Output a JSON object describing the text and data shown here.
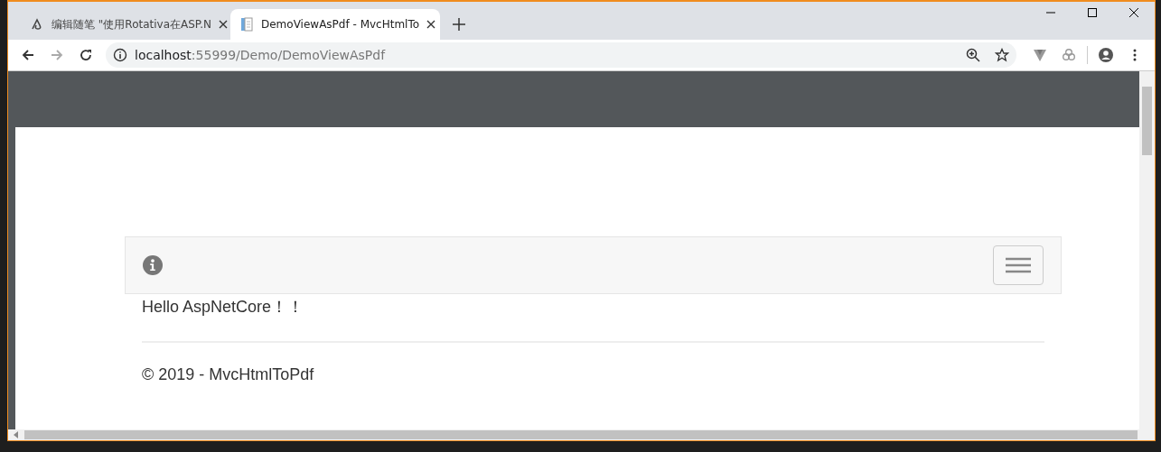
{
  "tabs": [
    {
      "title": "编辑随笔 \"使用Rotativa在ASP.N",
      "kind": "editor",
      "selected": false
    },
    {
      "title": "DemoViewAsPdf - MvcHtmlTo",
      "kind": "document",
      "selected": true
    }
  ],
  "address": {
    "host": "localhost",
    "path": ":55999/Demo/DemoViewAsPdf"
  },
  "page": {
    "message": "Hello AspNetCore！！",
    "footer": "© 2019 - MvcHtmlToPdf"
  }
}
